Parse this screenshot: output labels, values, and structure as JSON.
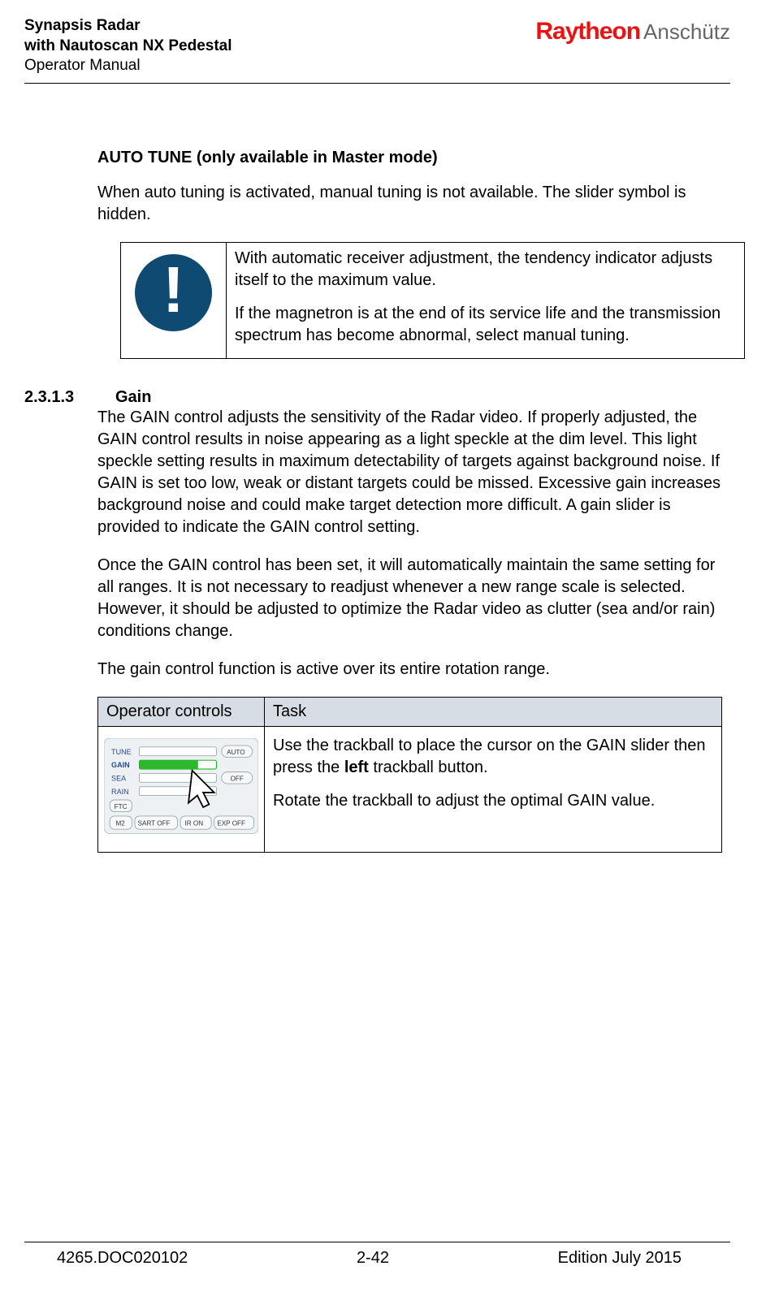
{
  "header": {
    "line1": "Synapsis Radar",
    "line2": "with Nautoscan NX Pedestal",
    "line3": "Operator Manual",
    "brand1": "Raytheon",
    "brand2": "Anschütz"
  },
  "autotune": {
    "title": "AUTO TUNE (only available in Master mode)",
    "para1": "When auto tuning is activated, manual tuning is not available. The slider symbol is hidden.",
    "note1": "With automatic receiver adjustment, the tendency indicator adjusts itself to the maximum value.",
    "note2": "If the magnetron is at the end of its service life and the transmission spectrum has become abnormal, select manual tuning."
  },
  "gain": {
    "number": "2.3.1.3",
    "title": "Gain",
    "para1": "The GAIN control adjusts the sensitivity of the Radar video. If properly adjusted, the GAIN control results in noise appearing as a light speckle at the dim level. This light speckle setting results in maximum detectability of targets against background noise. If GAIN is set too low, weak or distant targets could be missed. Excessive gain increases background noise and could make target detection more difficult. A gain slider is provided to indicate the GAIN control setting.",
    "para2": "Once the GAIN control has been set, it will automatically maintain the same setting for all ranges. It is not necessary to readjust whenever a new range scale is selected. However, it should be adjusted to optimize the Radar video as clutter (sea and/or rain) conditions change.",
    "para3": "The gain control function is active over its entire rotation range.",
    "table_header_left": "Operator controls",
    "table_header_right": "Task",
    "task1_a": "Use the trackball to place the cursor on the GAIN slider then press the ",
    "task1_bold": "left",
    "task1_b": " trackball button.",
    "task2": "Rotate the trackball to adjust the optimal GAIN value.",
    "panel": {
      "tune": "TUNE",
      "gain": "GAIN",
      "sea": "SEA",
      "rain": "RAIN",
      "ftc": "FTC",
      "auto": "AUTO",
      "off": "OFF",
      "m2": "M2",
      "sartoff": "SART OFF",
      "iron": "IR ON",
      "expoff": "EXP OFF"
    }
  },
  "footer": {
    "docnum": "4265.DOC020102",
    "pagenum": "2-42",
    "edition": "Edition July 2015"
  }
}
